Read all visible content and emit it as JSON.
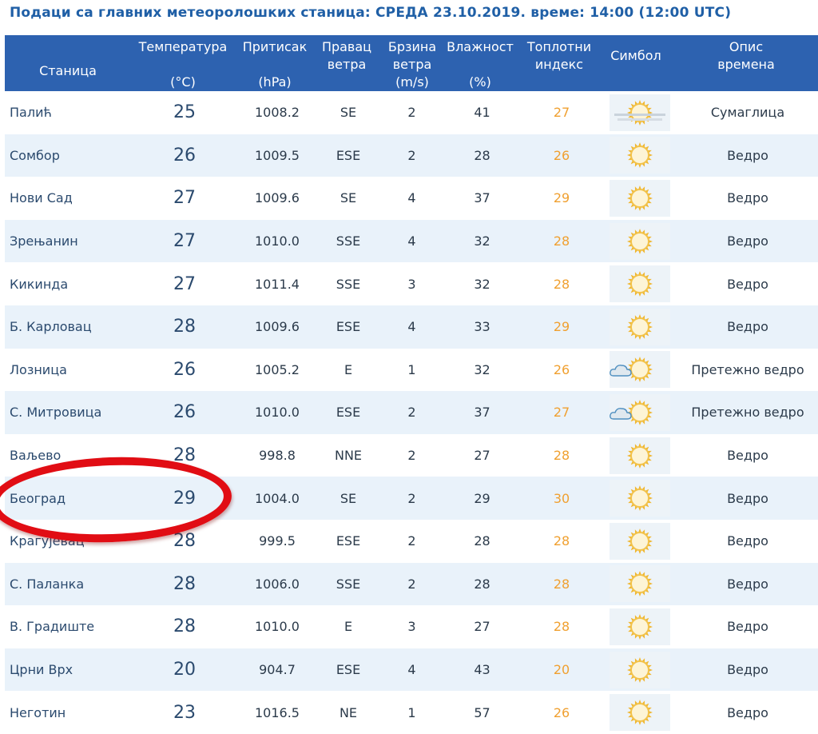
{
  "title": "Подаци са главних метеоролошких станица:  СРЕДА 23.10.2019.  време: 14:00 (12:00 UTC)",
  "headers": {
    "station": "Станица",
    "temp": "Температура",
    "temp_unit": "(°C)",
    "pressure": "Притисак",
    "pressure_unit": "(hPa)",
    "wind_dir_1": "Правац",
    "wind_dir_2": "ветра",
    "wind_speed_1": "Брзина",
    "wind_speed_2": "ветра",
    "wind_speed_unit": "(m/s)",
    "humidity": "Влажност",
    "humidity_unit": "(%)",
    "heat_1": "Топлотни",
    "heat_2": "индекс",
    "symbol": "Симбол",
    "desc_1": "Опис",
    "desc_2": "времена"
  },
  "rows": [
    {
      "station": "Палић",
      "temp": "25",
      "pressure": "1008.2",
      "dir": "SE",
      "speed": "2",
      "hum": "41",
      "heat": "27",
      "icon": "haze-sun-icon",
      "desc": "Сумаглица"
    },
    {
      "station": "Сомбор",
      "temp": "26",
      "pressure": "1009.5",
      "dir": "ESE",
      "speed": "2",
      "hum": "28",
      "heat": "26",
      "icon": "sun-icon",
      "desc": "Ведро"
    },
    {
      "station": "Нови Сад",
      "temp": "27",
      "pressure": "1009.6",
      "dir": "SE",
      "speed": "4",
      "hum": "37",
      "heat": "29",
      "icon": "sun-icon",
      "desc": "Ведро"
    },
    {
      "station": "Зрењанин",
      "temp": "27",
      "pressure": "1010.0",
      "dir": "SSE",
      "speed": "4",
      "hum": "32",
      "heat": "28",
      "icon": "sun-icon",
      "desc": "Ведро"
    },
    {
      "station": "Кикинда",
      "temp": "27",
      "pressure": "1011.4",
      "dir": "SSE",
      "speed": "3",
      "hum": "32",
      "heat": "28",
      "icon": "sun-icon",
      "desc": "Ведро"
    },
    {
      "station": "Б. Карловац",
      "temp": "28",
      "pressure": "1009.6",
      "dir": "ESE",
      "speed": "4",
      "hum": "33",
      "heat": "29",
      "icon": "sun-icon",
      "desc": "Ведро"
    },
    {
      "station": "Лозница",
      "temp": "26",
      "pressure": "1005.2",
      "dir": "E",
      "speed": "1",
      "hum": "32",
      "heat": "26",
      "icon": "sun-cloud-icon",
      "desc": "Претежно ведро"
    },
    {
      "station": "С. Митровица",
      "temp": "26",
      "pressure": "1010.0",
      "dir": "ESE",
      "speed": "2",
      "hum": "37",
      "heat": "27",
      "icon": "sun-cloud-icon",
      "desc": "Претежно ведро"
    },
    {
      "station": "Ваљево",
      "temp": "28",
      "pressure": "998.8",
      "dir": "NNE",
      "speed": "2",
      "hum": "27",
      "heat": "28",
      "icon": "sun-icon",
      "desc": "Ведро"
    },
    {
      "station": "Београд",
      "temp": "29",
      "pressure": "1004.0",
      "dir": "SE",
      "speed": "2",
      "hum": "29",
      "heat": "30",
      "icon": "sun-icon",
      "desc": "Ведро"
    },
    {
      "station": "Крагујевац",
      "temp": "28",
      "pressure": "999.5",
      "dir": "ESE",
      "speed": "2",
      "hum": "28",
      "heat": "28",
      "icon": "sun-icon",
      "desc": "Ведро"
    },
    {
      "station": "С. Паланка",
      "temp": "28",
      "pressure": "1006.0",
      "dir": "SSE",
      "speed": "2",
      "hum": "28",
      "heat": "28",
      "icon": "sun-icon",
      "desc": "Ведро"
    },
    {
      "station": "В. Градиште",
      "temp": "28",
      "pressure": "1010.0",
      "dir": "E",
      "speed": "3",
      "hum": "27",
      "heat": "28",
      "icon": "sun-icon",
      "desc": "Ведро"
    },
    {
      "station": "Црни Врх",
      "temp": "20",
      "pressure": "904.7",
      "dir": "ESE",
      "speed": "4",
      "hum": "43",
      "heat": "20",
      "icon": "sun-icon",
      "desc": "Ведро"
    },
    {
      "station": "Неготин",
      "temp": "23",
      "pressure": "1016.5",
      "dir": "NE",
      "speed": "1",
      "hum": "57",
      "heat": "26",
      "icon": "sun-icon",
      "desc": "Ведро"
    }
  ],
  "colors": {
    "header_bg": "#2d62b0",
    "title": "#1f5fa6",
    "row_alt": "#e9f2fa",
    "heat_index": "#f0a030",
    "highlight_circle": "#e10d14"
  },
  "annotation": {
    "icon": "red-circle-highlight"
  }
}
